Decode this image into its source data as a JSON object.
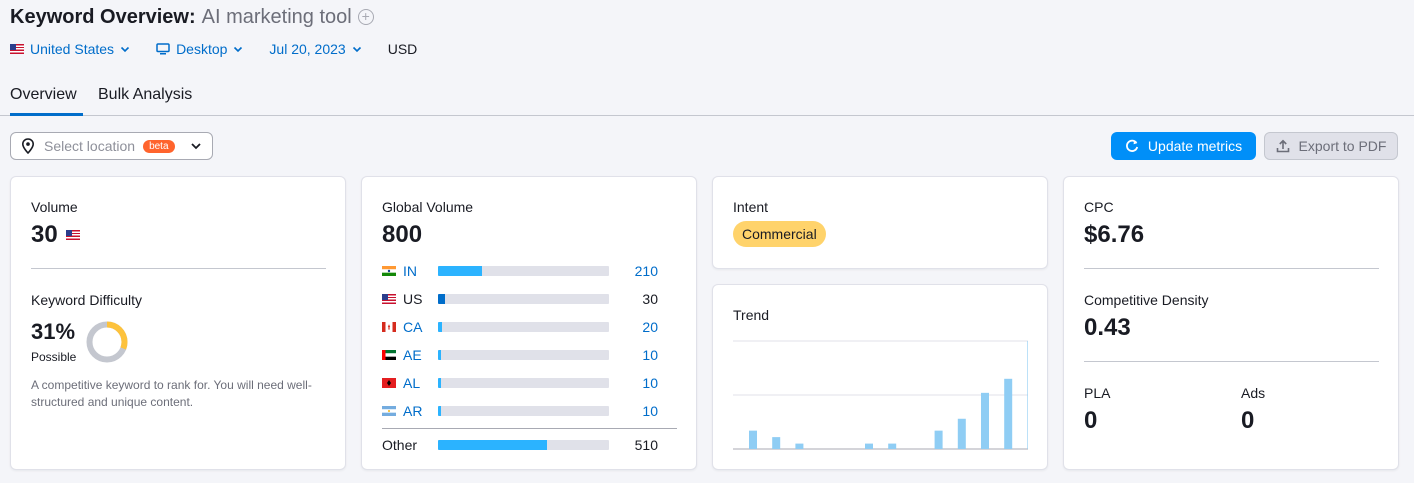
{
  "header": {
    "title": "Keyword Overview:",
    "keyword": "AI marketing tool",
    "add_icon": "plus-circle-icon"
  },
  "filters": {
    "database": "United States",
    "device": "Desktop",
    "date": "Jul 20, 2023",
    "currency": "USD"
  },
  "tabs": [
    {
      "label": "Overview",
      "active": true
    },
    {
      "label": "Bulk Analysis",
      "active": false
    }
  ],
  "location": {
    "placeholder": "Select location",
    "badge": "beta"
  },
  "actions": {
    "update": "Update metrics",
    "export": "Export to PDF"
  },
  "volume": {
    "label": "Volume",
    "value": "30"
  },
  "keyword_difficulty": {
    "label": "Keyword Difficulty",
    "value": "31%",
    "percent": 31,
    "level": "Possible",
    "description": "A competitive keyword to rank for. You will need well-structured and unique content.",
    "color": "#fdc23c"
  },
  "global_volume": {
    "label": "Global Volume",
    "value": "800",
    "rows": [
      {
        "code": "IN",
        "value": "210",
        "share": 0.26,
        "link": true
      },
      {
        "code": "US",
        "value": "30",
        "share": 0.04,
        "link": false
      },
      {
        "code": "CA",
        "value": "20",
        "share": 0.025,
        "link": true
      },
      {
        "code": "AE",
        "value": "10",
        "share": 0.015,
        "link": true
      },
      {
        "code": "AL",
        "value": "10",
        "share": 0.015,
        "link": true
      },
      {
        "code": "AR",
        "value": "10",
        "share": 0.015,
        "link": true
      }
    ],
    "other": {
      "label": "Other",
      "value": "510",
      "share": 0.64
    }
  },
  "intent": {
    "label": "Intent",
    "value": "Commercial",
    "color": "#ffd36b"
  },
  "trend": {
    "label": "Trend",
    "values": [
      0.17,
      0.11,
      0.05,
      0,
      0,
      0.05,
      0.05,
      0,
      0.17,
      0.28,
      0.52,
      0.65,
      1.0
    ],
    "color": "#8fcdf4"
  },
  "cpc": {
    "label": "CPC",
    "value": "$6.76"
  },
  "competitive_density": {
    "label": "Competitive Density",
    "value": "0.43"
  },
  "pla": {
    "label": "PLA",
    "value": "0"
  },
  "ads": {
    "label": "Ads",
    "value": "0"
  },
  "colors": {
    "accent": "#006dca",
    "primary_button": "#008ff8",
    "bar": "#2bb3ff",
    "bar_track": "#e0e1e9"
  }
}
